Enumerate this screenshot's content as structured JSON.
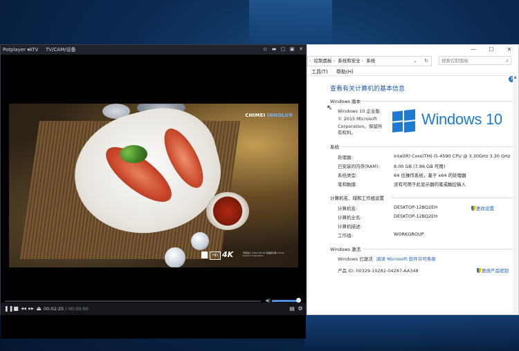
{
  "potplayer": {
    "menu_label": "Potplayer ▾",
    "tab_atv": "ATV",
    "tab_tvcam": "TV/CAM/设备",
    "window_controls": [
      "▫",
      "▬",
      "▢",
      "▣",
      "✕"
    ],
    "video": {
      "brand": "CHIMEI",
      "brand_suffix": "INNOLUX",
      "badge": "4K",
      "badge_hd": "HD",
      "credit": "奇美電子 ULTRA HD 4K 液晶顯示器 Chimei Innolux Corporation"
    },
    "time_current": "00:02:25",
    "time_separator": "/",
    "time_total": "00:00:00",
    "seek_progress": 0,
    "volume_level": 0.9,
    "buttons": {
      "pause": "❚❚",
      "stop": "■",
      "prev": "◀◀",
      "next": "▶▶",
      "eject": "⏏",
      "playlist": "▤",
      "settings": "⚙",
      "volume_icon": "◀)"
    }
  },
  "control_panel": {
    "window_buttons": [
      "—",
      "☐",
      "✕"
    ],
    "breadcrumb": [
      "控制面板",
      "系统和安全",
      "系统"
    ],
    "search_placeholder": "搜索控制面板",
    "menu": [
      "工具(T)",
      "帮助(H)"
    ],
    "heading": "查看有关计算机的基本信息",
    "windows_edition": {
      "section_title": "Windows 版本",
      "edition": "Windows 10 企业版",
      "copyright_line1": "© 2015 Microsoft",
      "copyright_line2": "Corporation。保留所",
      "copyright_line3": "有权利。",
      "logo_text": "Windows 10"
    },
    "system": {
      "section_title": "系统",
      "rows": [
        {
          "label": "处理器:",
          "value": "Intel(R) Core(TM) i5-4590 CPU @ 3.30GHz   3.30 GHz"
        },
        {
          "label": "已安装的内存(RAM):",
          "value": "8.00 GB (7.86 GB 可用)"
        },
        {
          "label": "系统类型:",
          "value": "64 位操作系统，基于 x64 的处理器"
        },
        {
          "label": "笔和触摸:",
          "value": "没有可用于此显示器的笔或触控输入"
        }
      ]
    },
    "computer": {
      "section_title": "计算机名、域和工作组设置",
      "rows": [
        {
          "label": "计算机名:",
          "value": "DESKTOP-12BQ2EH"
        },
        {
          "label": "计算机全名:",
          "value": "DESKTOP-12BQ2EH"
        },
        {
          "label": "计算机描述:",
          "value": ""
        },
        {
          "label": "工作组:",
          "value": "WORKGROUP"
        }
      ],
      "change_settings": "更改设置"
    },
    "activation": {
      "section_title": "Windows 激活",
      "status": "Windows 已激活",
      "license_link": "阅读 Microsoft 软件许可条款",
      "product_id": "产品 ID: 00329-10282-04287-AA348",
      "change_key": "更改产品密钥"
    }
  },
  "colors": {
    "accent_blue": "#1f7ad4",
    "link_blue": "#1a5fb4",
    "player_bg": "#0d0e12"
  }
}
